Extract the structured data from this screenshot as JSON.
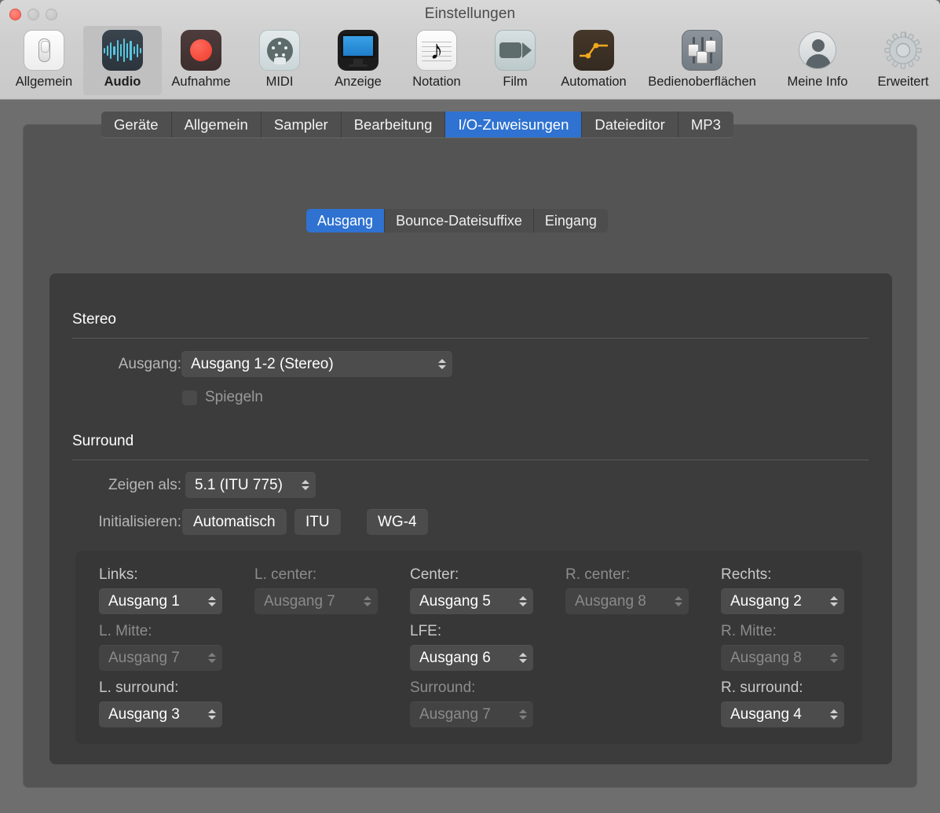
{
  "window": {
    "title": "Einstellungen",
    "traffic_lights": [
      "close",
      "minimize",
      "maximize"
    ]
  },
  "toolbar": {
    "items": [
      {
        "label": "Allgemein",
        "icon": "switch-icon",
        "selected": false
      },
      {
        "label": "Audio",
        "icon": "waveform-icon",
        "selected": true
      },
      {
        "label": "Aufnahme",
        "icon": "record-dot-icon",
        "selected": false
      },
      {
        "label": "MIDI",
        "icon": "midi-din-icon",
        "selected": false
      },
      {
        "label": "Anzeige",
        "icon": "display-icon",
        "selected": false
      },
      {
        "label": "Notation",
        "icon": "music-note-icon",
        "selected": false
      },
      {
        "label": "Film",
        "icon": "video-camera-icon",
        "selected": false
      },
      {
        "label": "Automation",
        "icon": "automation-curve-icon",
        "selected": false
      },
      {
        "label": "Bedienoberflächen",
        "icon": "faders-icon",
        "selected": false
      },
      {
        "label": "Meine Info",
        "icon": "user-avatar-icon",
        "selected": false
      },
      {
        "label": "Erweitert",
        "icon": "gear-icon",
        "selected": false
      }
    ]
  },
  "tabs": [
    {
      "label": "Geräte",
      "selected": false
    },
    {
      "label": "Allgemein",
      "selected": false
    },
    {
      "label": "Sampler",
      "selected": false
    },
    {
      "label": "Bearbeitung",
      "selected": false
    },
    {
      "label": "I/O-Zuweisungen",
      "selected": true
    },
    {
      "label": "Dateieditor",
      "selected": false
    },
    {
      "label": "MP3",
      "selected": false
    }
  ],
  "segmented": [
    {
      "label": "Ausgang",
      "selected": true
    },
    {
      "label": "Bounce-Dateisuffixe",
      "selected": false
    },
    {
      "label": "Eingang",
      "selected": false
    }
  ],
  "stereo": {
    "heading": "Stereo",
    "output_label": "Ausgang:",
    "output_value": "Ausgang 1-2 (Stereo)",
    "mirror_label": "Spiegeln",
    "mirror_checked": false,
    "mirror_enabled": false
  },
  "surround": {
    "heading": "Surround",
    "show_as_label": "Zeigen als:",
    "show_as_value": "5.1 (ITU 775)",
    "initialize_label": "Initialisieren:",
    "initialize_buttons": [
      "Automatisch",
      "ITU",
      "WG-4"
    ]
  },
  "assignments": {
    "row1": [
      {
        "label": "Links:",
        "value": "Ausgang 1",
        "enabled": true
      },
      {
        "label": "L. center:",
        "value": "Ausgang 7",
        "enabled": false
      },
      {
        "label": "Center:",
        "value": "Ausgang 5",
        "enabled": true
      },
      {
        "label": "R. center:",
        "value": "Ausgang 8",
        "enabled": false
      },
      {
        "label": "Rechts:",
        "value": "Ausgang 2",
        "enabled": true
      }
    ],
    "row2": [
      {
        "label": "L. Mitte:",
        "value": "Ausgang 7",
        "enabled": false
      },
      {
        "label": "LFE:",
        "value": "Ausgang 6",
        "enabled": true
      },
      {
        "label": "R. Mitte:",
        "value": "Ausgang 8",
        "enabled": false
      }
    ],
    "row3": [
      {
        "label": "L. surround:",
        "value": "Ausgang 3",
        "enabled": true
      },
      {
        "label": "Surround:",
        "value": "Ausgang 7",
        "enabled": false
      },
      {
        "label": "R. surround:",
        "value": "Ausgang 4",
        "enabled": true
      }
    ]
  },
  "colors": {
    "accent_blue": "#2f72d1",
    "window_bg": "#6e6e6e",
    "panel_bg": "#545454",
    "subpanel_bg": "#3c3c3c",
    "gridbox_bg": "#373737",
    "control_bg": "#4c4c4c",
    "text_primary": "#ffffff",
    "text_secondary": "#b6b6b6",
    "text_disabled": "#8c8c8c"
  }
}
